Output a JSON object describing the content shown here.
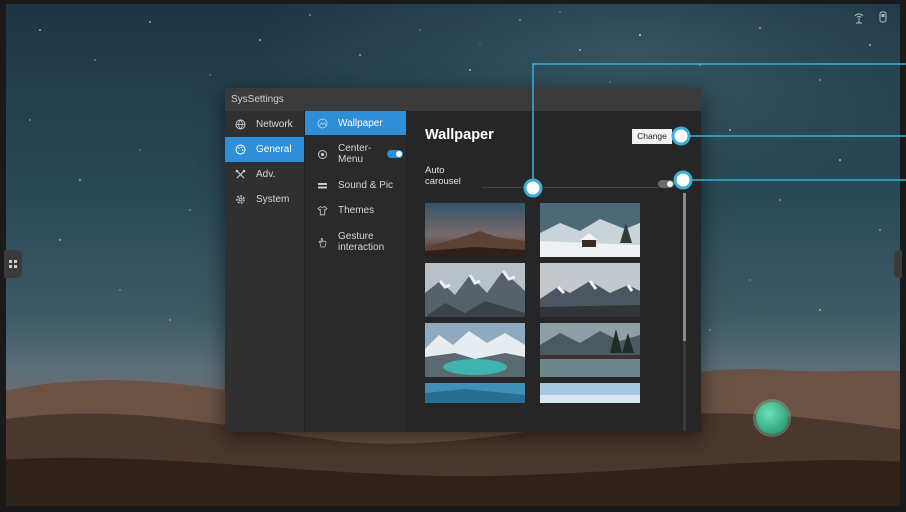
{
  "window": {
    "title": "SysSettings"
  },
  "nav": [
    {
      "label": "Network",
      "icon": "globe-icon",
      "active": false
    },
    {
      "label": "General",
      "icon": "palette-icon",
      "active": true
    },
    {
      "label": "Adv.",
      "icon": "tools-icon",
      "active": false
    },
    {
      "label": "System",
      "icon": "gear-icon",
      "active": false
    }
  ],
  "submenu": [
    {
      "label": "Wallpaper",
      "icon": "image-icon",
      "active": true
    },
    {
      "label": "Center-Menu",
      "icon": "target-icon",
      "toggle": true
    },
    {
      "label": "Sound & Pic",
      "icon": "sliders-icon"
    },
    {
      "label": "Themes",
      "icon": "shirt-icon"
    },
    {
      "label": "Gesture interaction",
      "icon": "hand-icon"
    }
  ],
  "content": {
    "heading": "Wallpaper",
    "change_label": "Change",
    "auto_carousel_label": "Auto carousel",
    "auto_carousel_on": false
  },
  "wallpapers": [
    "desert-mountain-sunset",
    "snowy-cabin",
    "snowy-peaks",
    "mountain-range-clouds",
    "glacier-lake",
    "lakeside-village",
    "partial-blue",
    "partial-sky"
  ],
  "colors": {
    "accent": "#2e8fd8",
    "callout": "#3bb0d6",
    "fab": "#3bbf92"
  }
}
